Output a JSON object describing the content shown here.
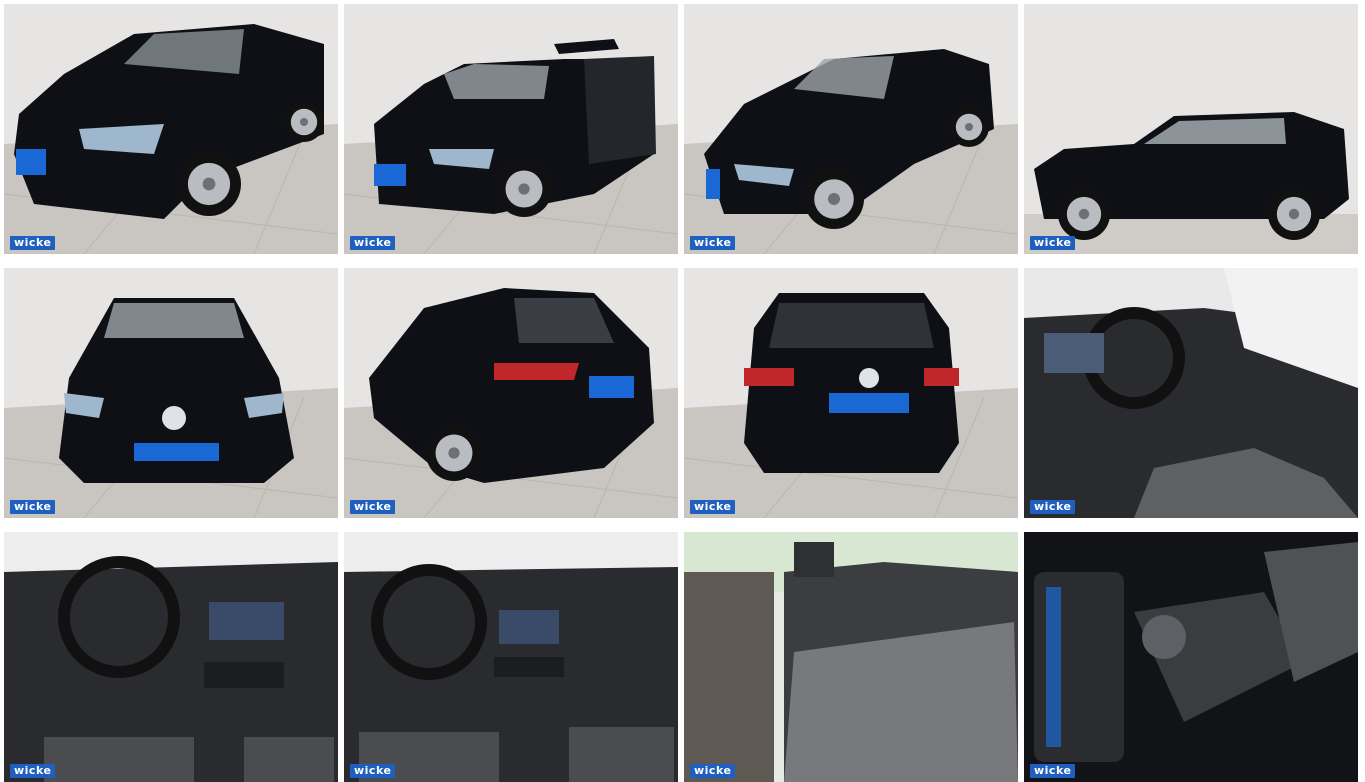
{
  "gallery": {
    "watermark": "wicke",
    "tiles": [
      {
        "name": "front-left-exterior",
        "kind": "ext-front34"
      },
      {
        "name": "doors-open-exterior",
        "kind": "ext-doors"
      },
      {
        "name": "front-angle-exterior",
        "kind": "ext-front34b"
      },
      {
        "name": "side-profile-exterior",
        "kind": "ext-side"
      },
      {
        "name": "front-view-exterior",
        "kind": "ext-front"
      },
      {
        "name": "rear-left-exterior",
        "kind": "ext-rear34"
      },
      {
        "name": "rear-view-exterior",
        "kind": "ext-rear"
      },
      {
        "name": "driver-seat-interior",
        "kind": "int-driver"
      },
      {
        "name": "dashboard-interior",
        "kind": "int-dash"
      },
      {
        "name": "dashboard-center-interior",
        "kind": "int-dash2"
      },
      {
        "name": "rear-seats-interior",
        "kind": "int-rear"
      },
      {
        "name": "center-console-interior",
        "kind": "int-console"
      }
    ]
  },
  "colors": {
    "car_body": "#0e1016",
    "wall": "#e6e5e3",
    "floor": "#c9c6c1",
    "interior": "#2a2b2e",
    "plate": "#1a67d6",
    "taillight": "#c0262a"
  }
}
